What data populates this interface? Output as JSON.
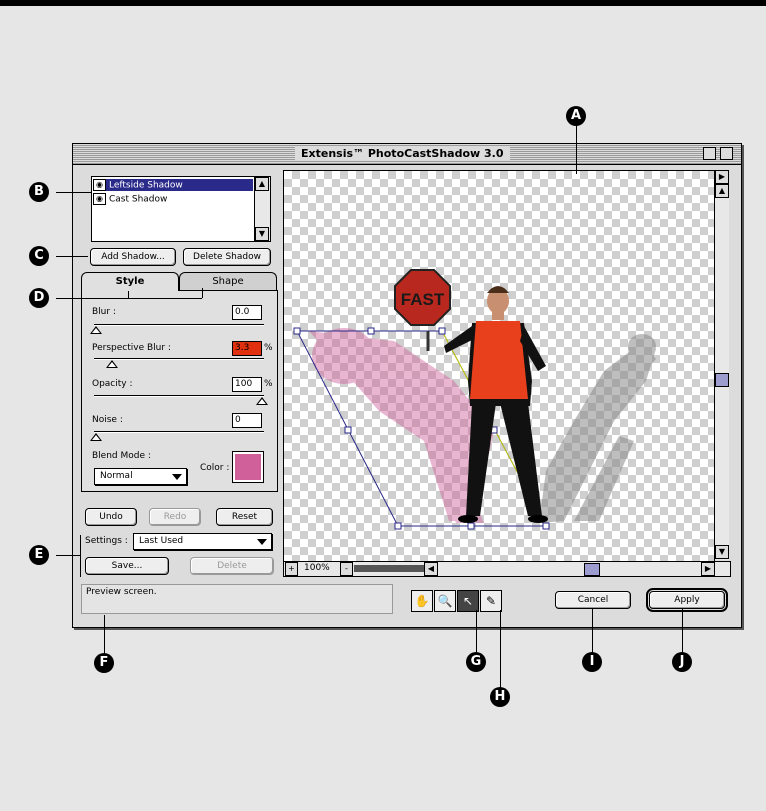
{
  "window": {
    "title": "Extensis™ PhotoCastShadow 3.0"
  },
  "shadows": {
    "items": [
      {
        "label": "Leftside Shadow",
        "selected": true
      },
      {
        "label": "Cast Shadow",
        "selected": false
      }
    ],
    "add_label": "Add Shadow...",
    "delete_label": "Delete Shadow"
  },
  "tabs": [
    {
      "label": "Style",
      "active": true
    },
    {
      "label": "Shape",
      "active": false
    }
  ],
  "style": {
    "blur_label": "Blur :",
    "blur_value": "0.0",
    "perspective_label": "Perspective Blur :",
    "perspective_value": "3.3",
    "perspective_unit": "%",
    "opacity_label": "Opacity :",
    "opacity_value": "100",
    "opacity_unit": "%",
    "noise_label": "Noise :",
    "noise_value": "0",
    "blend_label": "Blend Mode :",
    "blend_value": "Normal",
    "color_label": "Color :",
    "shadow_color": "#d0609a"
  },
  "history": {
    "undo": "Undo",
    "redo": "Redo",
    "reset": "Reset"
  },
  "settings": {
    "label": "Settings :",
    "value": "Last Used",
    "save": "Save...",
    "delete": "Delete"
  },
  "status": {
    "text": "Preview screen."
  },
  "zoom": {
    "value": "100%",
    "plus": "+",
    "minus": "-"
  },
  "preview": {
    "sign_text": "FAST"
  },
  "tools": [
    {
      "name": "hand",
      "glyph": "✋"
    },
    {
      "name": "zoom",
      "glyph": "🔍"
    },
    {
      "name": "select",
      "glyph": "↖"
    },
    {
      "name": "eyedropper",
      "glyph": "✎"
    }
  ],
  "actions": {
    "cancel": "Cancel",
    "apply": "Apply"
  },
  "callouts": {
    "A": "A",
    "B": "B",
    "C": "C",
    "D": "D",
    "E": "E",
    "F": "F",
    "G": "G",
    "H": "H",
    "I": "I",
    "J": "J"
  }
}
